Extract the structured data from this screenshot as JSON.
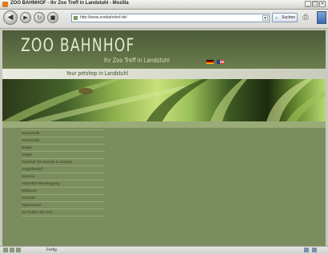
{
  "window": {
    "title": "ZOO BAHNHOF - Ihr Zoo Treff in Landstuhl - Mozilla",
    "controls": [
      "_",
      "□",
      "×"
    ]
  },
  "toolbar": {
    "back_icon": "back-arrow-icon",
    "forward_icon": "forward-arrow-icon",
    "reload_icon": "reload-icon",
    "stop_icon": "stop-icon",
    "url": "http://www.zoobahnhof.de/",
    "search_label": "Suchen",
    "print_icon": "print-icon"
  },
  "page": {
    "logo": "ZOO BAHNHOF",
    "subtitle": "Ihr Zoo Treff in Landstuhl",
    "tagline": "Your petshop in Landstuhl",
    "flags": [
      "de-flag-icon",
      "uk-flag-icon"
    ]
  },
  "nav": {
    "items": [
      "Aquaristik",
      "Terraristik",
      "Nager",
      "Vögel",
      "Zubehör für Hunde u. Katzen",
      "Angelbedarf",
      "Service",
      "Aktueller Neueingang",
      "Webcam",
      "Kontakt",
      "Impressum",
      "So finden Sie uns"
    ]
  },
  "statusbar": {
    "text": "Fertig"
  },
  "colors": {
    "header": "#5e6f44",
    "page_background": "#7b8c5e",
    "nav_text": "#4a5430"
  }
}
